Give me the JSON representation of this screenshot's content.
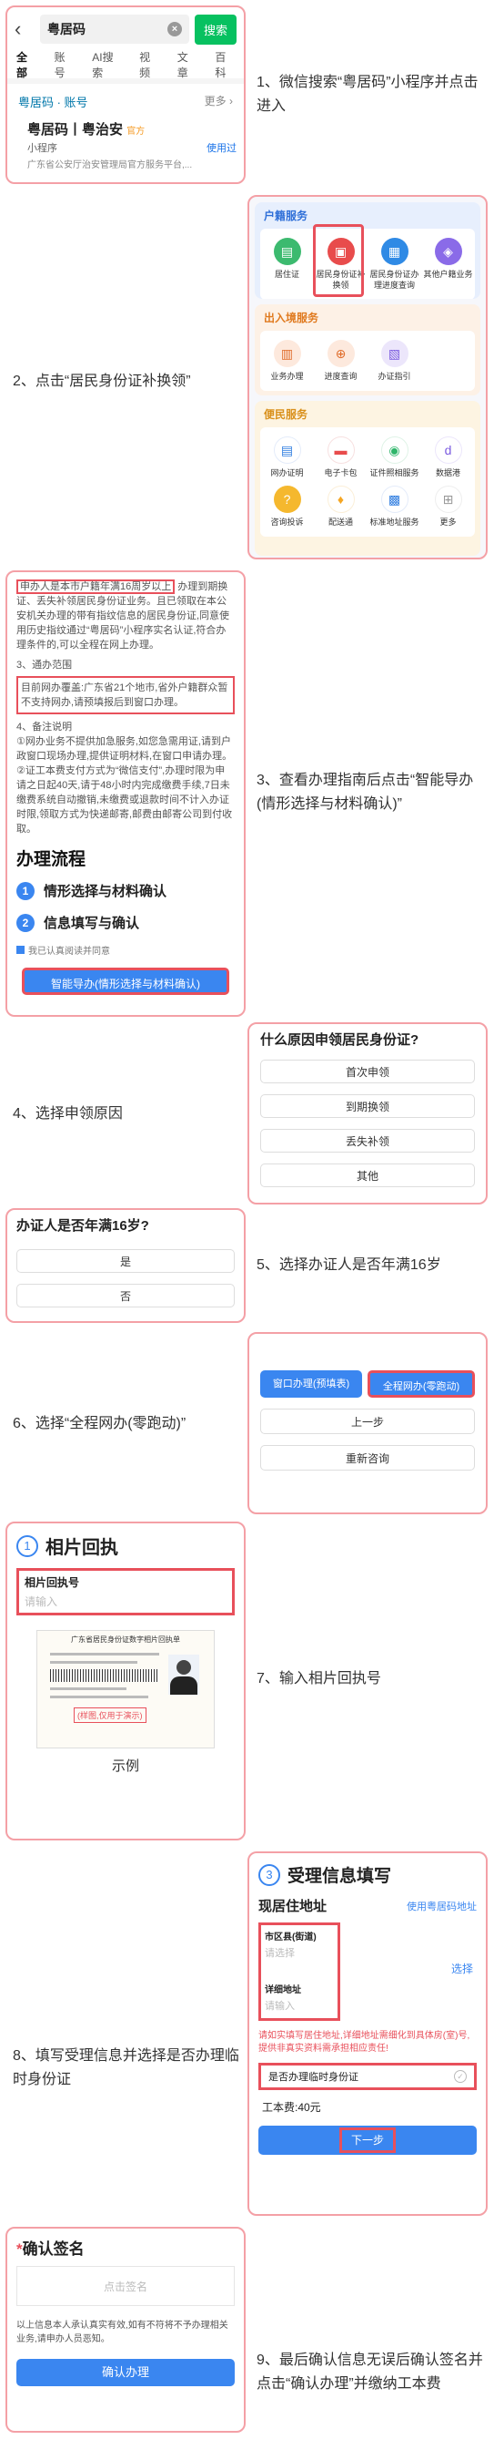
{
  "s1": {
    "query": "粤居码",
    "search_btn": "搜索",
    "tabs": [
      "全部",
      "账号",
      "AI搜索",
      "视频",
      "文章",
      "百科"
    ],
    "section": "粤居码 · 账号",
    "more": "更多 ›",
    "app_name": "粤居码丨粤治安",
    "app_tag": "官方",
    "app_type": "小程序",
    "used": "使用过",
    "app_desc": "广东省公安厅治安管理局官方服务平台,...",
    "caption": "1、微信搜索“粤居码”小程序并点击进入"
  },
  "s2": {
    "p1_title": "户籍服务",
    "p1_items": [
      "居住证",
      "居民身份证补换领",
      "居民身份证办理进度查询",
      "其他户籍业务"
    ],
    "p2_title": "出入境服务",
    "p2_items": [
      "业务办理",
      "进度查询",
      "办证指引"
    ],
    "p3_title": "便民服务",
    "p3_items": [
      "网办证明",
      "电子卡包",
      "证件照相服务",
      "数据港",
      "咨询投诉",
      "配送通",
      "标准地址服务",
      "更多"
    ],
    "caption": "2、点击“居民身份证补换领”"
  },
  "s3": {
    "line1_hl": "申办人是本市户籍年满16周岁以上",
    "line1_rest": "办理到期换证、丢失补领居民身份证业务。且已领取在本公安机关办理的带有指纹信息的居民身份证,同意使用历史指纹通过“粤居码”小程序实名认证,符合办理条件的,可以全程在网上办理。",
    "s3_title": "3、通办范围",
    "range_hl": "目前网办覆盖:广东省21个地市,省外户籍群众暂不支持网办,请预填报后到窗口办理。",
    "s4_title": "4、备注说明",
    "notes": "①网办业务不提供加急服务,如您急需用证,请到户政窗口现场办理,提供证明材料,在窗口申请办理。②证工本费支付方式为“微信支付”,办理时限为申请之日起40天,请于48小时内完成缴费手续,7日未缴费系统自动撤销,未缴费或退款时间不计入办证时限,领取方式为快递邮寄,邮费由邮寄公司到付收取。",
    "flow_title": "办理流程",
    "step1": "情形选择与材料确认",
    "step2": "信息填写与确认",
    "agree": "我已认真阅读并同意",
    "guide_btn": "智能导办(情形选择与材料确认)",
    "caption": "3、查看办理指南后点击“智能导办(情形选择与材料确认)”"
  },
  "s4": {
    "question": "什么原因申领居民身份证?",
    "opts": [
      "首次申领",
      "到期换领",
      "丢失补领",
      "其他"
    ],
    "caption": "4、选择申领原因"
  },
  "s5": {
    "question": "办证人是否年满16岁?",
    "opts": [
      "是",
      "否"
    ],
    "caption": "5、选择办证人是否年满16岁"
  },
  "s6": {
    "window_btn": "窗口办理(预填表)",
    "online_btn": "全程网办(零跑动)",
    "prev": "上一步",
    "restart": "重新咨询",
    "caption": "6、选择“全程网办(零跑动)”"
  },
  "s7": {
    "num": "1",
    "title": "相片回执",
    "field_label": "相片回执号",
    "placeholder": "请输入",
    "doc_title": "广东省居民身份证数字相片回执单",
    "doc_stamp": "(样图,仅用于演示)",
    "example": "示例",
    "caption": "7、输入相片回执号"
  },
  "s8": {
    "num": "3",
    "title": "受理信息填写",
    "addr_title": "现居住地址",
    "use_code": "使用粤居码地址",
    "district_label": "市区县(街道)",
    "district_ph": "请选择",
    "choose": "选择",
    "detail_label": "详细地址",
    "detail_ph": "请输入",
    "warn": "请如实填写居住地址,详细地址需细化到具体房(室)号,提供非真实资料需承担相应责任!",
    "temp_id": "是否办理临时身份证",
    "fee": "工本费:40元",
    "next": "下一步",
    "caption": "8、填写受理信息并选择是否办理临时身份证"
  },
  "s9": {
    "title": "确认签名",
    "star": "*",
    "sign_ph": "点击签名",
    "declare": "以上信息本人承认真实有效,如有不符将不予办理相关业务,请申办人员恶知。",
    "confirm": "确认办理",
    "caption": "9、最后确认信息无误后确认签名并点击“确认办理”并缴纳工本费"
  },
  "colors": {
    "accent": "#3a86f0",
    "highlight": "#e8505b",
    "card_border": "#f4a0a6",
    "green": "#07c160"
  }
}
